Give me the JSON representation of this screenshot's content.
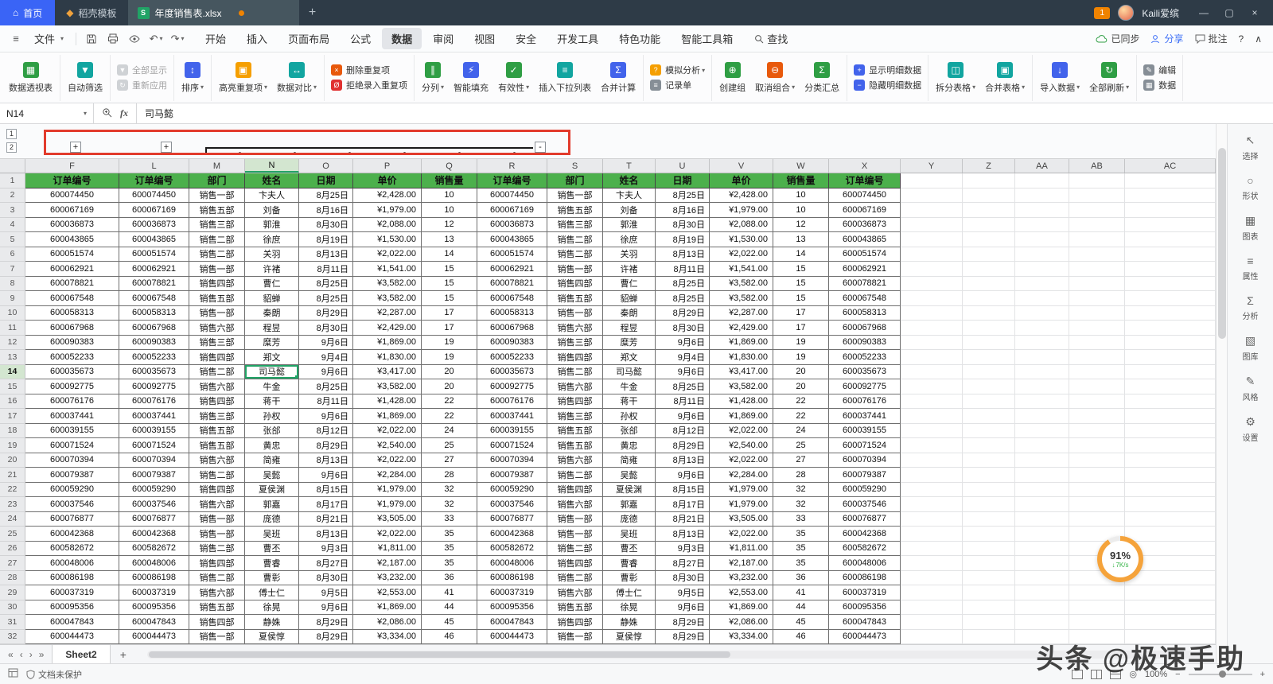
{
  "title_bar": {
    "home": "首页",
    "template": "稻壳模板",
    "doc": "年度销售表.xlsx",
    "badge": "1",
    "user": "Kaili爱缤"
  },
  "menu": {
    "file": "文件",
    "tabs": [
      "开始",
      "插入",
      "页面布局",
      "公式",
      "数据",
      "审阅",
      "视图",
      "安全",
      "开发工具",
      "特色功能",
      "智能工具箱"
    ],
    "active_tab": "数据",
    "find": "查找",
    "sync": "已同步",
    "share": "分享",
    "comment": "批注",
    "help": "?"
  },
  "ribbon": {
    "groups": [
      {
        "stack": false,
        "items": [
          {
            "label": "数据透视表",
            "icon": "pivot-table-icon"
          }
        ]
      },
      {
        "stack": false,
        "items": [
          {
            "label": "自动筛选",
            "icon": "auto-filter-icon"
          }
        ]
      },
      {
        "stack": true,
        "items": [
          {
            "label": "全部显示",
            "icon": "show-all-icon",
            "disabled": true
          },
          {
            "label": "重新应用",
            "icon": "reapply-icon",
            "disabled": true
          }
        ]
      },
      {
        "stack": false,
        "items": [
          {
            "label": "排序",
            "icon": "sort-icon",
            "caret": true
          }
        ]
      },
      {
        "stack": false,
        "items": [
          {
            "label": "高亮重复项",
            "icon": "highlight-dup-icon",
            "caret": true
          },
          {
            "label": "数据对比",
            "icon": "compare-icon",
            "caret": true
          }
        ]
      },
      {
        "stack": true,
        "items": [
          {
            "label": "删除重复项",
            "icon": "delete-dup-icon"
          },
          {
            "label": "拒绝录入重复项",
            "icon": "reject-dup-icon"
          }
        ]
      },
      {
        "stack": false,
        "items": [
          {
            "label": "分列",
            "icon": "split-cols-icon",
            "caret": true
          },
          {
            "label": "智能填充",
            "icon": "smart-fill-icon"
          },
          {
            "label": "有效性",
            "icon": "validity-icon",
            "caret": true
          },
          {
            "label": "插入下拉列表",
            "icon": "dropdown-list-icon"
          },
          {
            "label": "合并计算",
            "icon": "merge-calc-icon"
          }
        ]
      },
      {
        "stack": true,
        "items": [
          {
            "label": "模拟分析",
            "icon": "simulate-icon",
            "caret": true
          },
          {
            "label": "记录单",
            "icon": "record-icon"
          }
        ]
      },
      {
        "stack": false,
        "items": [
          {
            "label": "创建组",
            "icon": "create-group-icon"
          },
          {
            "label": "取消组合",
            "icon": "ungroup-icon",
            "caret": true
          },
          {
            "label": "分类汇总",
            "icon": "subtotal-icon"
          }
        ]
      },
      {
        "stack": true,
        "items": [
          {
            "label": "显示明细数据",
            "icon": "show-detail-icon"
          },
          {
            "label": "隐藏明细数据",
            "icon": "hide-detail-icon"
          }
        ]
      },
      {
        "stack": false,
        "items": [
          {
            "label": "拆分表格",
            "icon": "split-table-icon",
            "caret": true
          },
          {
            "label": "合并表格",
            "icon": "merge-table-icon",
            "caret": true
          }
        ]
      },
      {
        "stack": false,
        "items": [
          {
            "label": "导入数据",
            "icon": "import-data-icon",
            "caret": true
          },
          {
            "label": "全部刷新",
            "icon": "refresh-icon",
            "caret": true
          }
        ]
      },
      {
        "stack": true,
        "items": [
          {
            "label": "编辑",
            "icon": "edit-icon"
          },
          {
            "label": "数据",
            "icon": "data-icon"
          }
        ]
      }
    ]
  },
  "formula_bar": {
    "name_box": "N14",
    "fx_label": "fx",
    "content": "司马懿"
  },
  "outline": {
    "levels": [
      "1",
      "2"
    ],
    "plus": "+",
    "minus": "-"
  },
  "grid": {
    "columns": [
      "F",
      "L",
      "M",
      "N",
      "O",
      "P",
      "Q",
      "R",
      "S",
      "T",
      "U",
      "V",
      "W",
      "X",
      "Y",
      "Z",
      "AA",
      "AB",
      "AC"
    ],
    "selected_column": "N",
    "selected_row": 14
  },
  "table": {
    "headers": [
      "订单编号",
      "订单编号",
      "部门",
      "姓名",
      "日期",
      "单价",
      "销售量",
      "订单编号",
      "部门",
      "姓名",
      "日期",
      "单价",
      "销售量",
      "订单编号"
    ],
    "records": [
      {
        "order_id": "600074450",
        "dept": "销售一部",
        "name": "卞夫人",
        "date": "8月25日",
        "price": "¥2,428.00",
        "qty": "10"
      },
      {
        "order_id": "600067169",
        "dept": "销售五部",
        "name": "刘备",
        "date": "8月16日",
        "price": "¥1,979.00",
        "qty": "10"
      },
      {
        "order_id": "600036873",
        "dept": "销售三部",
        "name": "郭淮",
        "date": "8月30日",
        "price": "¥2,088.00",
        "qty": "12"
      },
      {
        "order_id": "600043865",
        "dept": "销售二部",
        "name": "徐庶",
        "date": "8月19日",
        "price": "¥1,530.00",
        "qty": "13"
      },
      {
        "order_id": "600051574",
        "dept": "销售二部",
        "name": "关羽",
        "date": "8月13日",
        "price": "¥2,022.00",
        "qty": "14"
      },
      {
        "order_id": "600062921",
        "dept": "销售一部",
        "name": "许褚",
        "date": "8月11日",
        "price": "¥1,541.00",
        "qty": "15"
      },
      {
        "order_id": "600078821",
        "dept": "销售四部",
        "name": "曹仁",
        "date": "8月25日",
        "price": "¥3,582.00",
        "qty": "15"
      },
      {
        "order_id": "600067548",
        "dept": "销售五部",
        "name": "貂蝉",
        "date": "8月25日",
        "price": "¥3,582.00",
        "qty": "15"
      },
      {
        "order_id": "600058313",
        "dept": "销售一部",
        "name": "秦朗",
        "date": "8月29日",
        "price": "¥2,287.00",
        "qty": "17"
      },
      {
        "order_id": "600067968",
        "dept": "销售六部",
        "name": "程昱",
        "date": "8月30日",
        "price": "¥2,429.00",
        "qty": "17"
      },
      {
        "order_id": "600090383",
        "dept": "销售三部",
        "name": "糜芳",
        "date": "9月6日",
        "price": "¥1,869.00",
        "qty": "19"
      },
      {
        "order_id": "600052233",
        "dept": "销售四部",
        "name": "郑文",
        "date": "9月4日",
        "price": "¥1,830.00",
        "qty": "19"
      },
      {
        "order_id": "600035673",
        "dept": "销售二部",
        "name": "司马懿",
        "date": "9月6日",
        "price": "¥3,417.00",
        "qty": "20"
      },
      {
        "order_id": "600092775",
        "dept": "销售六部",
        "name": "牛金",
        "date": "8月25日",
        "price": "¥3,582.00",
        "qty": "20"
      },
      {
        "order_id": "600076176",
        "dept": "销售四部",
        "name": "蒋干",
        "date": "8月11日",
        "price": "¥1,428.00",
        "qty": "22"
      },
      {
        "order_id": "600037441",
        "dept": "销售三部",
        "name": "孙权",
        "date": "9月6日",
        "price": "¥1,869.00",
        "qty": "22"
      },
      {
        "order_id": "600039155",
        "dept": "销售五部",
        "name": "张郃",
        "date": "8月12日",
        "price": "¥2,022.00",
        "qty": "24"
      },
      {
        "order_id": "600071524",
        "dept": "销售五部",
        "name": "黄忠",
        "date": "8月29日",
        "price": "¥2,540.00",
        "qty": "25"
      },
      {
        "order_id": "600070394",
        "dept": "销售六部",
        "name": "简雍",
        "date": "8月13日",
        "price": "¥2,022.00",
        "qty": "27"
      },
      {
        "order_id": "600079387",
        "dept": "销售二部",
        "name": "吴懿",
        "date": "9月6日",
        "price": "¥2,284.00",
        "qty": "28"
      },
      {
        "order_id": "600059290",
        "dept": "销售四部",
        "name": "夏侯渊",
        "date": "8月15日",
        "price": "¥1,979.00",
        "qty": "32"
      },
      {
        "order_id": "600037546",
        "dept": "销售六部",
        "name": "郭嘉",
        "date": "8月17日",
        "price": "¥1,979.00",
        "qty": "32"
      },
      {
        "order_id": "600076877",
        "dept": "销售一部",
        "name": "庞德",
        "date": "8月21日",
        "price": "¥3,505.00",
        "qty": "33"
      },
      {
        "order_id": "600042368",
        "dept": "销售一部",
        "name": "吴班",
        "date": "8月13日",
        "price": "¥2,022.00",
        "qty": "35"
      },
      {
        "order_id": "600582672",
        "dept": "销售二部",
        "name": "曹丕",
        "date": "9月3日",
        "price": "¥1,811.00",
        "qty": "35"
      },
      {
        "order_id": "600048006",
        "dept": "销售四部",
        "name": "曹睿",
        "date": "8月27日",
        "price": "¥2,187.00",
        "qty": "35"
      },
      {
        "order_id": "600086198",
        "dept": "销售二部",
        "name": "曹彰",
        "date": "8月30日",
        "price": "¥3,232.00",
        "qty": "36"
      },
      {
        "order_id": "600037319",
        "dept": "销售六部",
        "name": "傅士仁",
        "date": "9月5日",
        "price": "¥2,553.00",
        "qty": "41"
      },
      {
        "order_id": "600095356",
        "dept": "销售五部",
        "name": "徐晃",
        "date": "9月6日",
        "price": "¥1,869.00",
        "qty": "44"
      },
      {
        "order_id": "600047843",
        "dept": "销售四部",
        "name": "静姝",
        "date": "8月29日",
        "price": "¥2,086.00",
        "qty": "45"
      },
      {
        "order_id": "600044473",
        "dept": "销售一部",
        "name": "夏侯惇",
        "date": "8月29日",
        "price": "¥3,334.00",
        "qty": "46"
      }
    ]
  },
  "sheet_tabs": {
    "active": "Sheet2",
    "add": "+"
  },
  "status": {
    "protection": "文档未保护",
    "zoom": "100%"
  },
  "net_widget": {
    "percent": "91%",
    "speed": "7K/s"
  },
  "watermark": "头条 @极速手助",
  "right_panel": {
    "items": [
      {
        "label": "选择",
        "icon": "cursor-icon"
      },
      {
        "label": "形状",
        "icon": "shape-icon"
      },
      {
        "label": "图表",
        "icon": "chart-icon"
      },
      {
        "label": "属性",
        "icon": "property-icon"
      },
      {
        "label": "分析",
        "icon": "analysis-icon"
      },
      {
        "label": "图库",
        "icon": "gallery-icon"
      },
      {
        "label": "风格",
        "icon": "style-icon"
      },
      {
        "label": "设置",
        "icon": "settings-icon"
      }
    ]
  }
}
